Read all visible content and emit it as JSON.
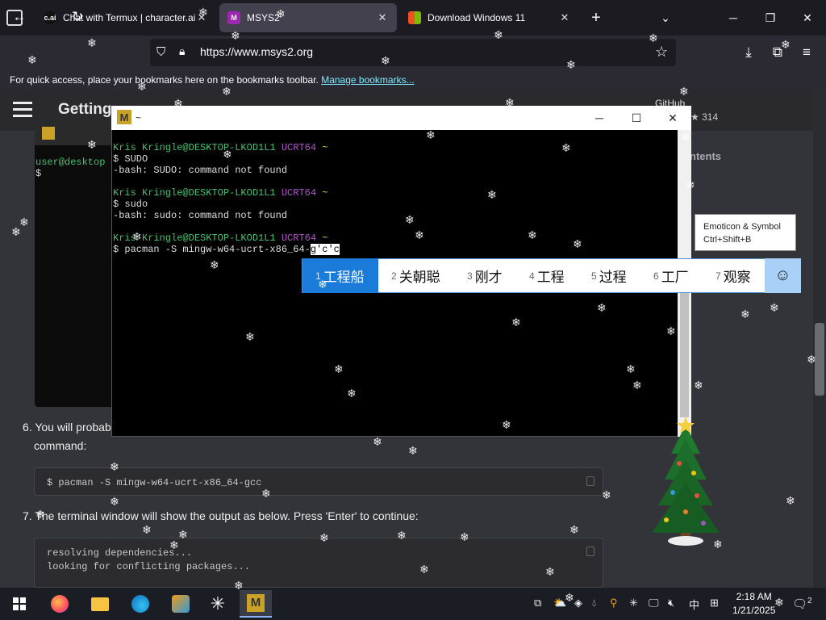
{
  "browser": {
    "tabs": [
      {
        "title": "Chat with Termux | character.ai",
        "favicon": "c.ai"
      },
      {
        "title": "MSYS2",
        "favicon": "M"
      },
      {
        "title": "Download Windows 11",
        "favicon": "ms"
      }
    ],
    "new_tab": "+",
    "url": "https://www.msys2.org",
    "bookmarks_text": "For quick access, place your bookmarks here on the bookmarks toolbar.",
    "bookmarks_link": "Manage bookmarks..."
  },
  "site": {
    "title": "Getting",
    "github": "GitHub",
    "stars": "314",
    "contents": "ntents",
    "mini_prompt": "user@desktop",
    "mini_dollar": "$",
    "step6a": "6. You will probab",
    "step6b": "command:",
    "code1": "$ pacman -S mingw-w64-ucrt-x86_64-gcc",
    "step7": "7. The terminal window will show the output as below. Press 'Enter' to continue:",
    "code2a": "resolving dependencies...",
    "code2b": "looking for conflicting packages..."
  },
  "terminal": {
    "title": "~",
    "lines": [
      {
        "user": "Kris Kringle@DESKTOP-LKOD1L1",
        "env": "UCRT64",
        "dir": "~"
      },
      {
        "cmd": "$ SUDO"
      },
      {
        "out": "-bash: SUDO: command not found"
      },
      {
        "user": "Kris Kringle@DESKTOP-LKOD1L1",
        "env": "UCRT64",
        "dir": "~"
      },
      {
        "cmd": "$ sudo"
      },
      {
        "out": "-bash: sudo: command not found"
      },
      {
        "user": "Kris Kringle@DESKTOP-LKOD1L1",
        "env": "UCRT64",
        "dir": "~"
      },
      {
        "cmd": "$ pacman -S mingw-w64-ucrt-x86_64-",
        "composing": "g'c'c"
      }
    ]
  },
  "ime": {
    "candidates": [
      {
        "n": "1",
        "text": "工程船"
      },
      {
        "n": "2",
        "text": "关朝聪"
      },
      {
        "n": "3",
        "text": "刚才"
      },
      {
        "n": "4",
        "text": "工程"
      },
      {
        "n": "5",
        "text": "过程"
      },
      {
        "n": "6",
        "text": "工厂"
      },
      {
        "n": "7",
        "text": "观察"
      }
    ],
    "tooltip_line1": "Emoticon & Symbol",
    "tooltip_line2": "Ctrl+Shift+B",
    "selected_index": 0
  },
  "taskbar": {
    "time": "2:18 AM",
    "date": "1/21/2025",
    "ime_lang": "中",
    "notifications": "2"
  },
  "colors": {
    "prompt_user": "#3fc46e",
    "prompt_env": "#b452cd",
    "ime_selected": "#1a7bd8"
  }
}
